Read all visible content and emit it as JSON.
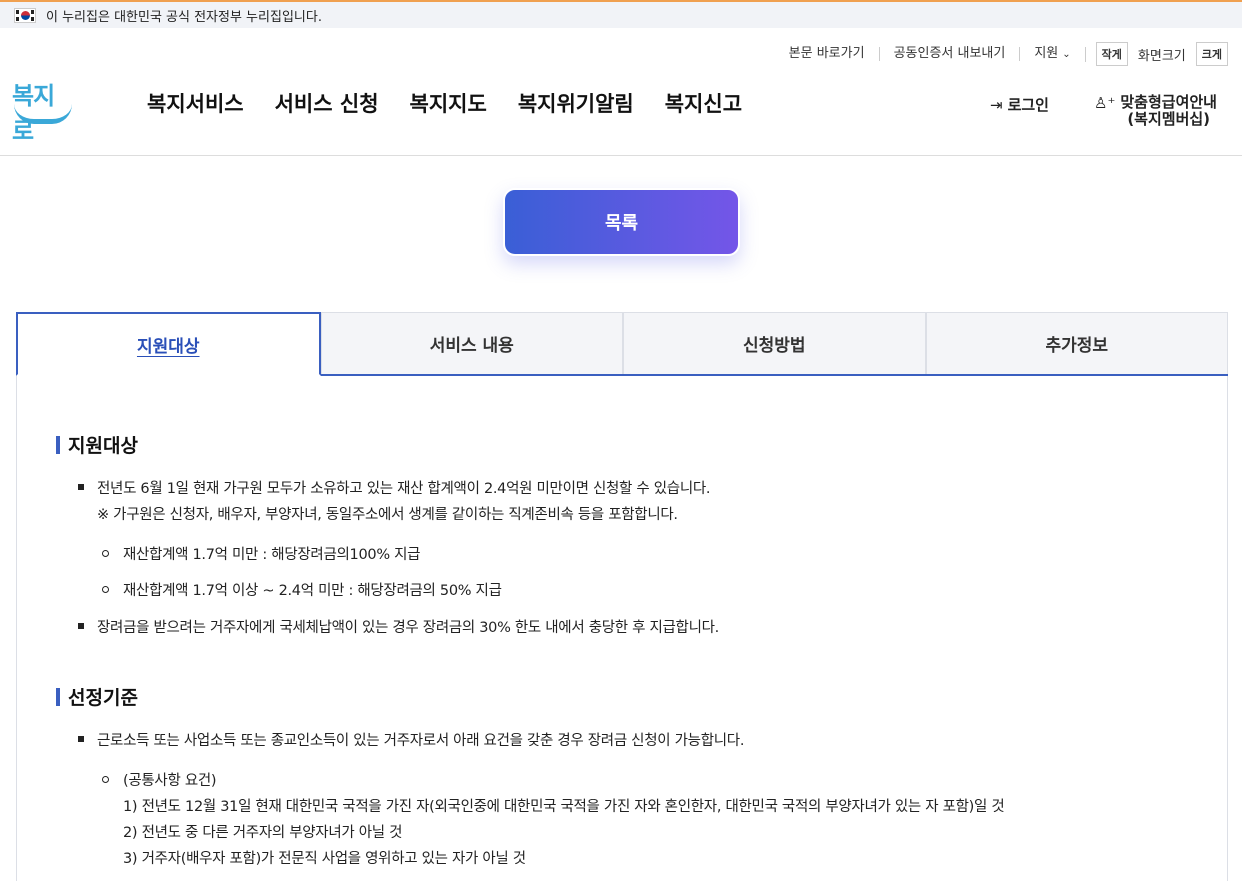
{
  "gov_banner": {
    "text": "이 누리집은 대한민국 공식 전자정부 누리집입니다."
  },
  "utility": {
    "skip": "본문 바로가기",
    "cert": "공동인증서 내보내기",
    "support": "지원",
    "small": "작게",
    "size_label": "화면크기",
    "large": "크게"
  },
  "logo": {
    "text": "복지로"
  },
  "gnb": [
    "복지서비스",
    "서비스 신청",
    "복지지도",
    "복지위기알림",
    "복지신고"
  ],
  "account": {
    "login": "로그인",
    "member_line1": "맞춤형급여안내",
    "member_line2": "(복지멤버십)"
  },
  "list_button": "목록",
  "tabs": [
    "지원대상",
    "서비스 내용",
    "신청방법",
    "추가정보"
  ],
  "sections": {
    "s1_title": "지원대상",
    "s1_b1_l1": "전년도 6월 1일 현재 가구원 모두가 소유하고 있는 재산 합계액이 2.4억원 미만이면 신청할 수 있습니다.",
    "s1_b1_l2": "※ 가구원은 신청자, 배우자, 부양자녀, 동일주소에서 생계를 같이하는 직계존비속 등을 포함합니다.",
    "s1_c1": "재산합계액 1.7억 미만 : 해당장려금의100% 지급",
    "s1_c2": "재산합계액 1.7억 이상 ~ 2.4억 미만 : 해당장려금의 50% 지급",
    "s1_b2": "장려금을 받으려는 거주자에게 국세체납액이 있는 경우 장려금의 30% 한도 내에서 충당한 후 지급합니다.",
    "s2_title": "선정기준",
    "s2_b1": "근로소득 또는 사업소득 또는 종교인소득이 있는 거주자로서 아래 요건을 갖춘 경우 장려금 신청이 가능합니다.",
    "s2_c1_l1": "(공통사항 요건)",
    "s2_c1_l2": "1) 전년도 12월 31일 현재 대한민국 국적을 가진 자(외국인중에 대한민국 국적을 가진 자와 혼인한자, 대한민국 국적의 부양자녀가 있는 자 포함)일 것",
    "s2_c1_l3": "2) 전년도 중 다른 거주자의 부양자녀가 아닐 것",
    "s2_c1_l4": "3) 거주자(배우자 포함)가 전문직 사업을 영위하고 있는 자가 아닐 것"
  },
  "colors": {
    "accent": "#3a5fc0",
    "brand": "#3aa8d8",
    "button_start": "#3a5fd6",
    "button_end": "#7456e8"
  },
  "icons": [
    "flag-icon",
    "chevron-down-icon",
    "login-icon",
    "user-plus-icon"
  ]
}
